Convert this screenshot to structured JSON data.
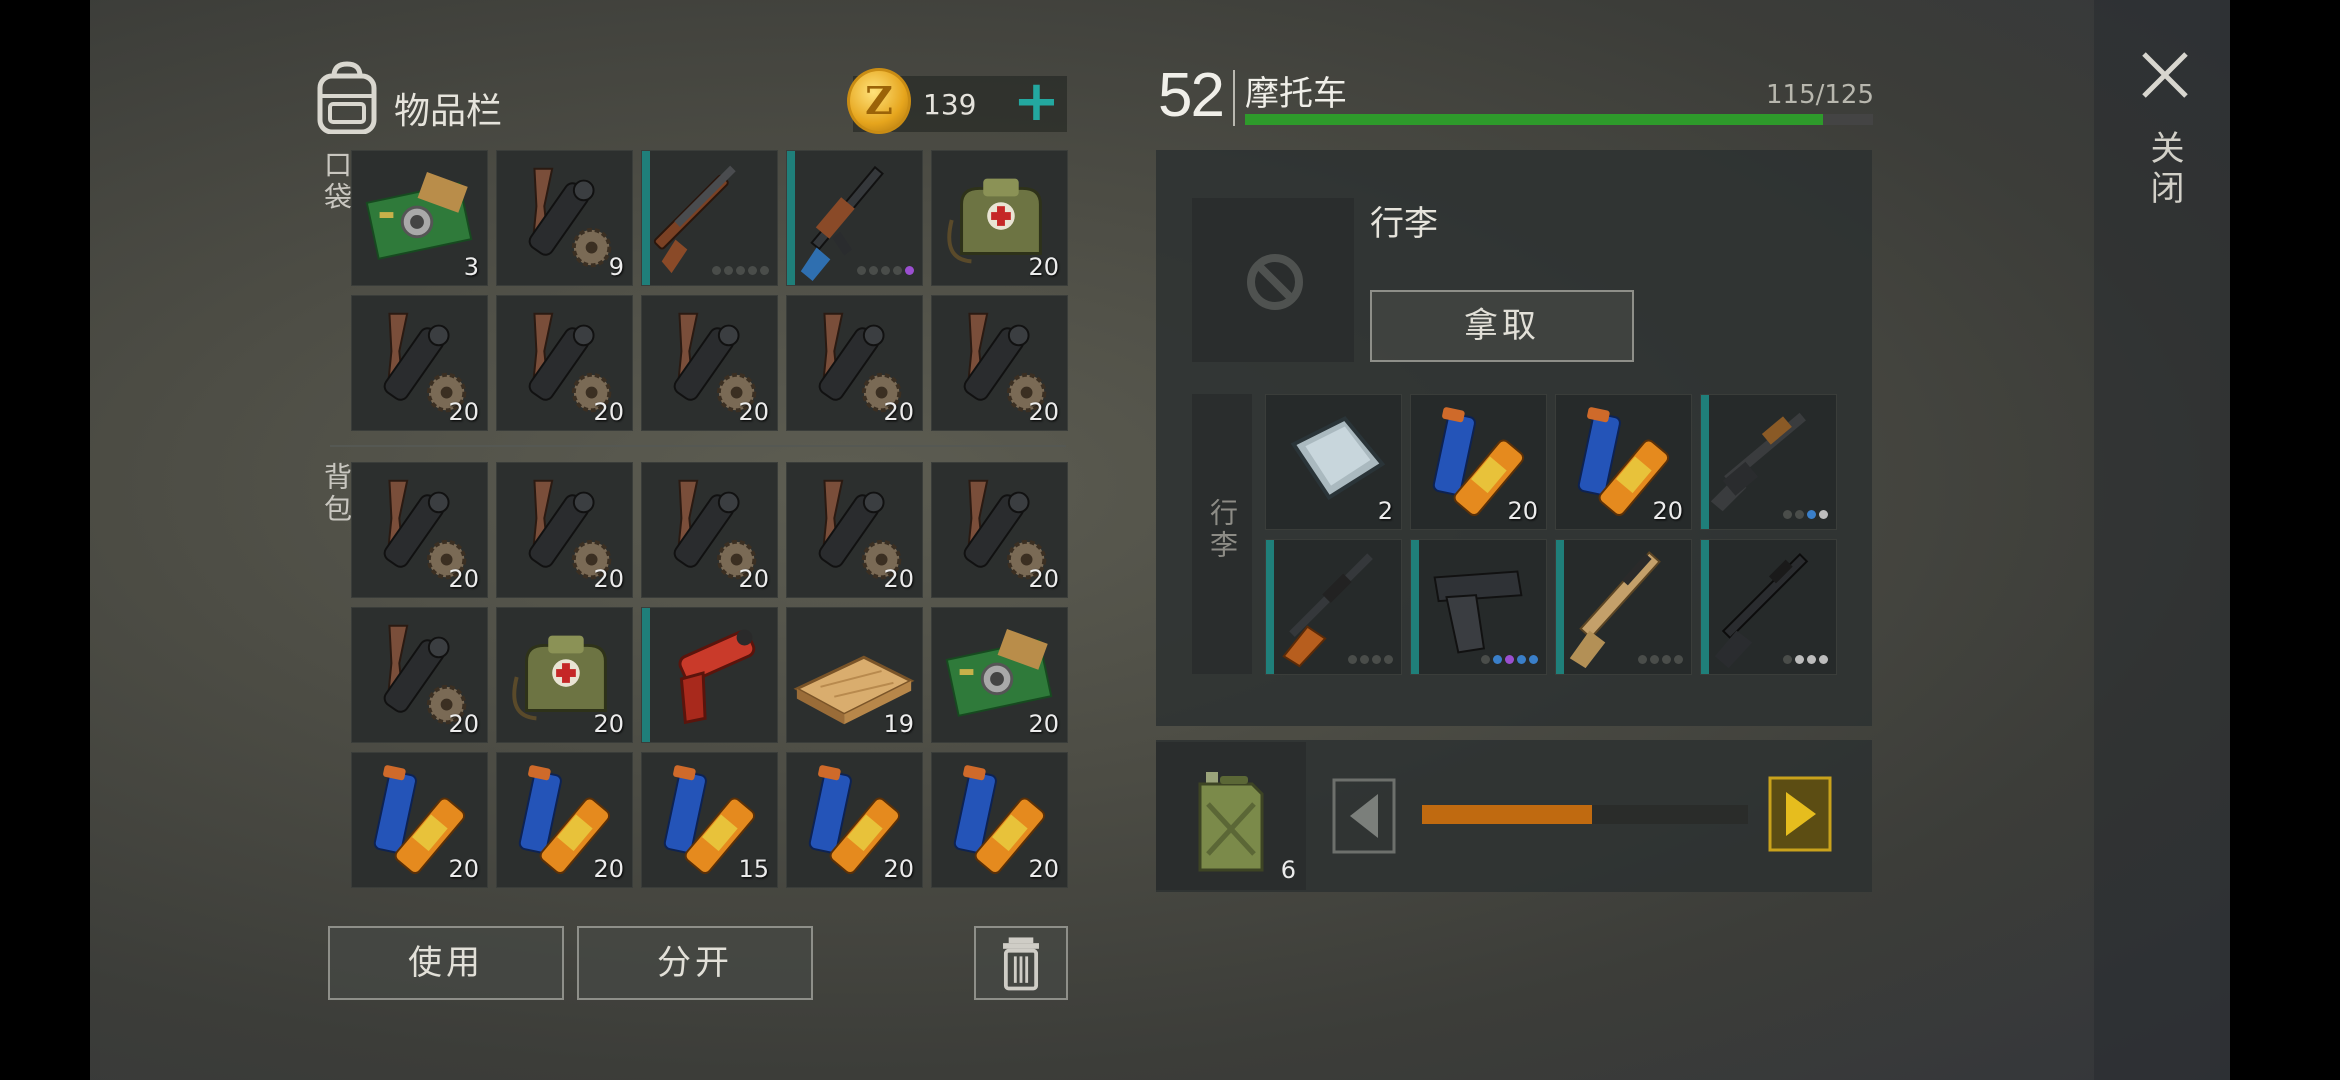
{
  "inventory": {
    "title": "物品栏",
    "coins": "139",
    "coin_symbol": "Z",
    "pockets_label": "口袋",
    "backpack_label": "背包",
    "pockets": [
      {
        "icon": "circuit-board-icon",
        "count": "3"
      },
      {
        "icon": "scope-parts-icon",
        "count": "9"
      },
      {
        "icon": "shotgun-icon",
        "count": "",
        "dots": [
          "#4a4d4a",
          "#4a4d4a",
          "#4a4d4a",
          "#4a4d4a",
          "#4a4d4a"
        ],
        "teal": true
      },
      {
        "icon": "assault-rifle-icon",
        "count": "",
        "dots": [
          "#4a4d4a",
          "#4a4d4a",
          "#4a4d4a",
          "#4a4d4a",
          "#9b4fd0"
        ],
        "teal": true
      },
      {
        "icon": "medical-bag-icon",
        "count": "20"
      },
      {
        "icon": "scope-parts-icon",
        "count": "20"
      },
      {
        "icon": "scope-parts-icon",
        "count": "20"
      },
      {
        "icon": "scope-parts-icon",
        "count": "20"
      },
      {
        "icon": "scope-parts-icon",
        "count": "20"
      },
      {
        "icon": "scope-parts-icon",
        "count": "20"
      }
    ],
    "backpack": [
      {
        "icon": "scope-parts-icon",
        "count": "20"
      },
      {
        "icon": "scope-parts-icon",
        "count": "20"
      },
      {
        "icon": "scope-parts-icon",
        "count": "20"
      },
      {
        "icon": "scope-parts-icon",
        "count": "20"
      },
      {
        "icon": "scope-parts-icon",
        "count": "20"
      },
      {
        "icon": "scope-parts-icon",
        "count": "20"
      },
      {
        "icon": "medical-bag-icon",
        "count": "20"
      },
      {
        "icon": "flare-gun-icon",
        "count": "",
        "teal": true
      },
      {
        "icon": "wood-plank-icon",
        "count": "19"
      },
      {
        "icon": "circuit-board-icon",
        "count": "20"
      },
      {
        "icon": "battery-icon",
        "count": "20"
      },
      {
        "icon": "battery-icon",
        "count": "20"
      },
      {
        "icon": "battery-icon",
        "count": "15"
      },
      {
        "icon": "battery-icon",
        "count": "20"
      },
      {
        "icon": "battery-icon",
        "count": "20"
      }
    ],
    "use_label": "使用",
    "split_label": "分开"
  },
  "vehicle": {
    "level": "52",
    "name": "摩托车",
    "hp_text": "115/125",
    "hp_fraction": 0.92,
    "luggage_title": "行李",
    "take_label": "拿取",
    "storage_label": "行李",
    "storage": [
      {
        "icon": "metal-plate-icon",
        "count": "2"
      },
      {
        "icon": "battery-icon",
        "count": "20"
      },
      {
        "icon": "battery-icon",
        "count": "20"
      },
      {
        "icon": "pump-shotgun-icon",
        "count": "",
        "dots": [
          "#4a4d4a",
          "#4a4d4a",
          "#3a7fc9",
          "#bdbdbd"
        ],
        "teal": true
      },
      {
        "icon": "dragunov-rifle-icon",
        "count": "",
        "dots": [
          "#4a4d4a",
          "#4a4d4a",
          "#4a4d4a",
          "#4a4d4a"
        ],
        "teal": true
      },
      {
        "icon": "pistol-icon",
        "count": "",
        "dots": [
          "#4a4d4a",
          "#3a7fc9",
          "#9b4fd0",
          "#3a7fc9",
          "#3a7fc9"
        ],
        "teal": true
      },
      {
        "icon": "scar-rifle-icon",
        "count": "",
        "dots": [
          "#4a4d4a",
          "#4a4d4a",
          "#4a4d4a",
          "#4a4d4a"
        ],
        "teal": true
      },
      {
        "icon": "m16-rifle-icon",
        "count": "",
        "dots": [
          "#4a4d4a",
          "#bdbdbd",
          "#bdbdbd",
          "#bdbdbd"
        ],
        "teal": true
      }
    ],
    "fuel_count": "6",
    "fuel_fraction": 0.52
  },
  "close_label": "关闭"
}
